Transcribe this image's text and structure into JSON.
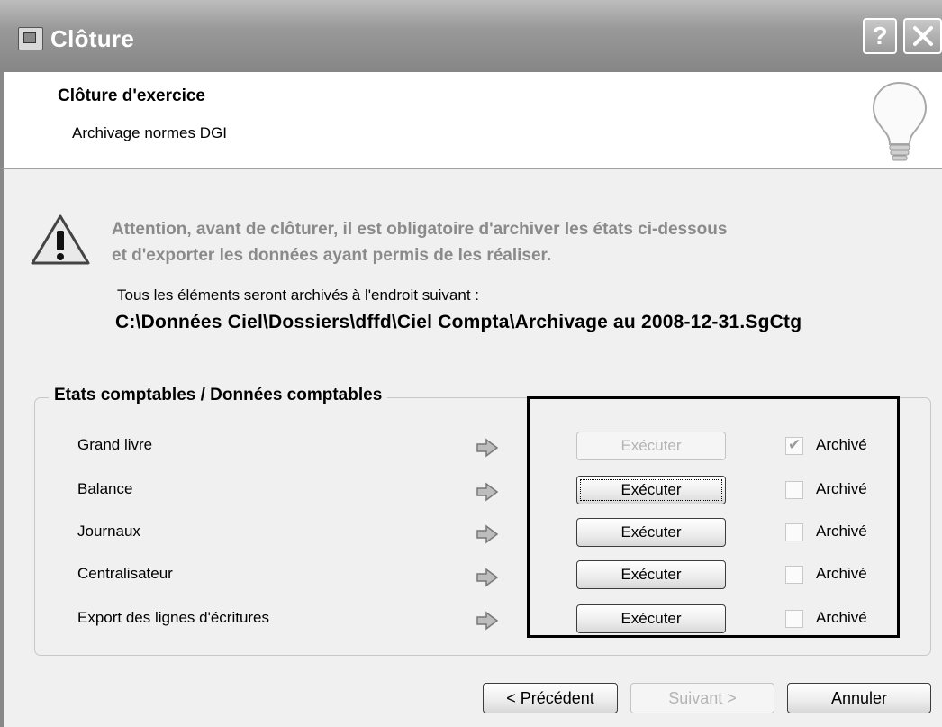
{
  "window": {
    "title": "Clôture",
    "help_label": "?",
    "close_label": "×"
  },
  "header": {
    "heading": "Clôture d'exercice",
    "subheading": "Archivage normes DGI"
  },
  "warning": {
    "line1": "Attention, avant de clôturer, il est obligatoire d'archiver les états ci-dessous",
    "line2": "et d'exporter les données ayant permis de les réaliser."
  },
  "archive": {
    "intro": "Tous les éléments seront archivés à l'endroit suivant :",
    "path": "C:\\Données Ciel\\Dossiers\\dffd\\Ciel Compta\\Archivage au 2008-12-31.SgCtg"
  },
  "group": {
    "title": "Etats comptables / Données comptables",
    "rows": [
      {
        "label": "Grand livre",
        "button": "Exécuter",
        "button_enabled": false,
        "archived": true,
        "check_label": "Archivé"
      },
      {
        "label": "Balance",
        "button": "Exécuter",
        "button_enabled": true,
        "archived": false,
        "check_label": "Archivé"
      },
      {
        "label": "Journaux",
        "button": "Exécuter",
        "button_enabled": true,
        "archived": false,
        "check_label": "Archivé"
      },
      {
        "label": "Centralisateur",
        "button": "Exécuter",
        "button_enabled": true,
        "archived": false,
        "check_label": "Archivé"
      },
      {
        "label": "Export des lignes d'écritures",
        "button": "Exécuter",
        "button_enabled": true,
        "archived": false,
        "check_label": "Archivé"
      }
    ]
  },
  "footer": {
    "prev_label": "< Précédent",
    "next_label": "Suivant >",
    "next_enabled": false,
    "cancel_label": "Annuler"
  },
  "icons": {
    "app": "app-window-icon",
    "bulb": "lightbulb-icon",
    "warning": "warning-icon",
    "row_arrow": "arrow-right-icon"
  }
}
